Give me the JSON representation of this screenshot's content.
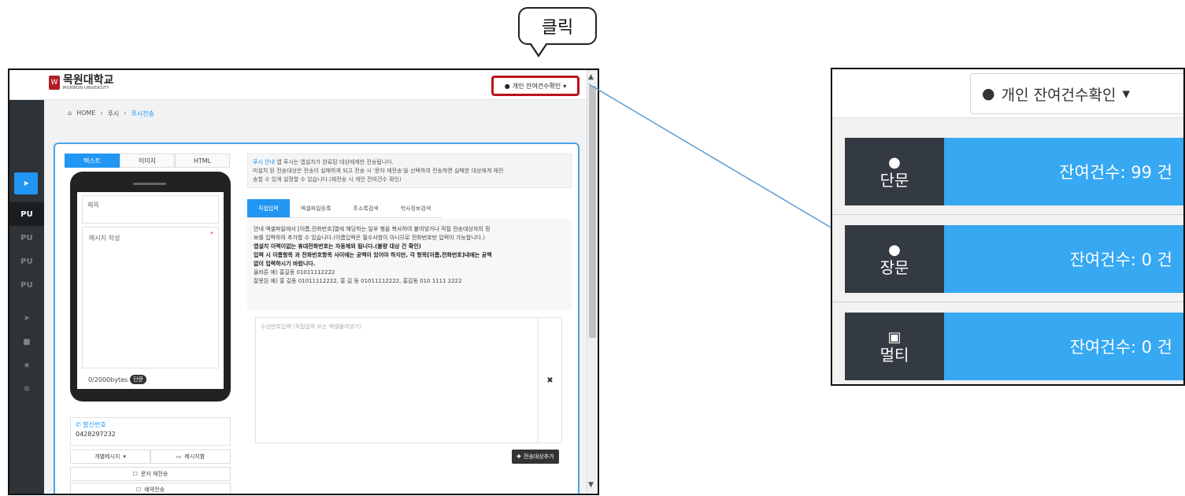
{
  "callout": {
    "label": "클릭"
  },
  "app": {
    "logo_mark": "W",
    "logo_title": "목원대학교",
    "logo_sub": "MOKWON UNIVERSITY",
    "remain_button": "개인 잔여건수확인",
    "breadcrumb": [
      "HOME",
      "푸시",
      "푸시전송"
    ],
    "sidebar": [
      "PU",
      "PU",
      "PU",
      "PU"
    ],
    "left_tabs": [
      "텍스트",
      "이미지",
      "HTML"
    ],
    "subject_placeholder": "제목",
    "message_placeholder": "메시지 작성",
    "bytes": "0/2000bytes",
    "bytes_badge": "단문",
    "sender_label": "발신번호",
    "sender_number": "0428297232",
    "individual_msg": "개별메시지",
    "msg_box": "메시지함",
    "resend": "문자 재전송",
    "resend2": "예약전송",
    "notice_hl": "푸시 안내",
    "notice_line1": " 앱 푸시는 앱설치가 완료된 대상에게만 전송됩니다.",
    "notice_line2": "미설치 된 전송대상은 전송이 실패하게 되고 전송 시 '문자 재전송'을 선택하여 전송하면 실패한 대상에게 재전",
    "notice_line3": "송할 수 있게 설정할 수 있습니다.(재전송 시 개인 잔여건수 확인)",
    "right_tabs": [
      "직접입력",
      "엑셀파일등록",
      "주소록검색",
      "학사정보검색"
    ],
    "guide_line1": "안내 엑셀파일에서 [이름,전화번호]열에 해당하는 일부 행을 복사하여 붙여넣거나 직접 전송대상자의 정",
    "guide_line2": "보를 입력하여 추가할 수 있습니다.(이름입력은 필수사항이 아니므로 전화번호만 입력이 가능합니다.)",
    "guide_line3": "앱설치 이력이없는 휴대전화번호는 자동제외 됩니다.(불량 대상 건 확인)",
    "guide_line4": "입력 시 이름항목 과 전화번호항목 사이에는 공백이 있어야 하지만, 각 항목[이름,전화번호]내에는 공백",
    "guide_line5": "없이 입력하시기 바랍니다.",
    "guide_line6": "올바른 예) 홍길동 01011112222",
    "guide_line7": "잘못된 예) 홍 길동 01011112222, 홍 길 동 01011112222, 홍길동 010 1111 2222",
    "recv_placeholder": "수신번호입력 (직접입력 또는 엑셀붙여넣기)",
    "add_target": "전송대상추가"
  },
  "zoom": {
    "button": "개인 잔여건수확인",
    "rows": [
      {
        "type": "단문",
        "value": "잔여건수: 99 건",
        "icon": "speech-bubble-icon"
      },
      {
        "type": "장문",
        "value": "잔여건수: 0 건",
        "icon": "speech-bubble-icon"
      },
      {
        "type": "멀티",
        "value": "잔여건수: 0 건",
        "icon": "image-icon"
      }
    ]
  },
  "colors": {
    "accent": "#2196f3",
    "highlight": "#b8141c",
    "connector": "#5b9bd5",
    "tile_dark": "#333a42",
    "tile_blue": "#37a8f2"
  }
}
